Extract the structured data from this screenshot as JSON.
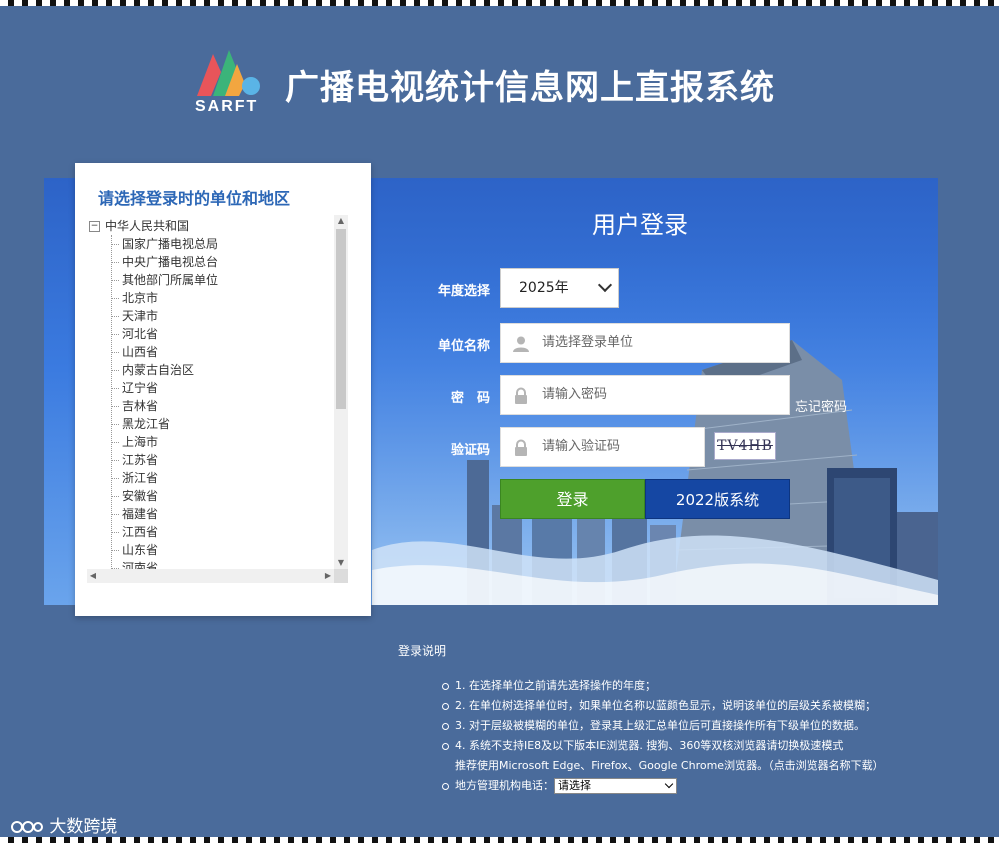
{
  "header": {
    "logo_text": "SARFT",
    "title": "广播电视统计信息网上直报系统"
  },
  "tree": {
    "title": "请选择登录时的单位和地区",
    "root": "中华人民共和国",
    "items": [
      "国家广播电视总局",
      "中央广播电视总台",
      "其他部门所属单位",
      "北京市",
      "天津市",
      "河北省",
      "山西省",
      "内蒙古自治区",
      "辽宁省",
      "吉林省",
      "黑龙江省",
      "上海市",
      "江苏省",
      "浙江省",
      "安徽省",
      "福建省",
      "江西省",
      "山东省",
      "河南省"
    ]
  },
  "login": {
    "title": "用户登录",
    "year_label": "年度选择",
    "year_value": "2025年",
    "unit_label": "单位名称",
    "unit_placeholder": "请选择登录单位",
    "password_label": "密　码",
    "password_placeholder": "请输入密码",
    "forgot": "忘记密码",
    "captcha_label": "验证码",
    "captcha_placeholder": "请输入验证码",
    "captcha_image_text": "TV4HB",
    "login_button": "登录",
    "old_system_button": "2022版系统"
  },
  "instructions": {
    "title": "登录说明",
    "items": [
      "1. 在选择单位之前请先选择操作的年度；",
      "2. 在单位树选择单位时，如果单位名称以蓝颜色显示，说明该单位的层级关系被模糊；",
      "3. 对于层级被模糊的单位，登录其上级汇总单位后可直接操作所有下级单位的数据。",
      "4. 系统不支持IE8及以下版本IE浏览器. 搜狗、360等双核浏览器请切换极速模式"
    ],
    "browser_line": "推荐使用Microsoft Edge、Firefox、Google Chrome浏览器。（点击浏览器名称下载）",
    "contact_label": "地方管理机构电话：",
    "contact_select": "请选择"
  },
  "watermark": {
    "brand": "大数跨境"
  },
  "colors": {
    "page_bg": "#4a6b9b",
    "band_blue": "#2d63c7",
    "login_green": "#4ea02c",
    "old_system_blue": "#1547a3",
    "tree_title": "#2c67b6"
  }
}
